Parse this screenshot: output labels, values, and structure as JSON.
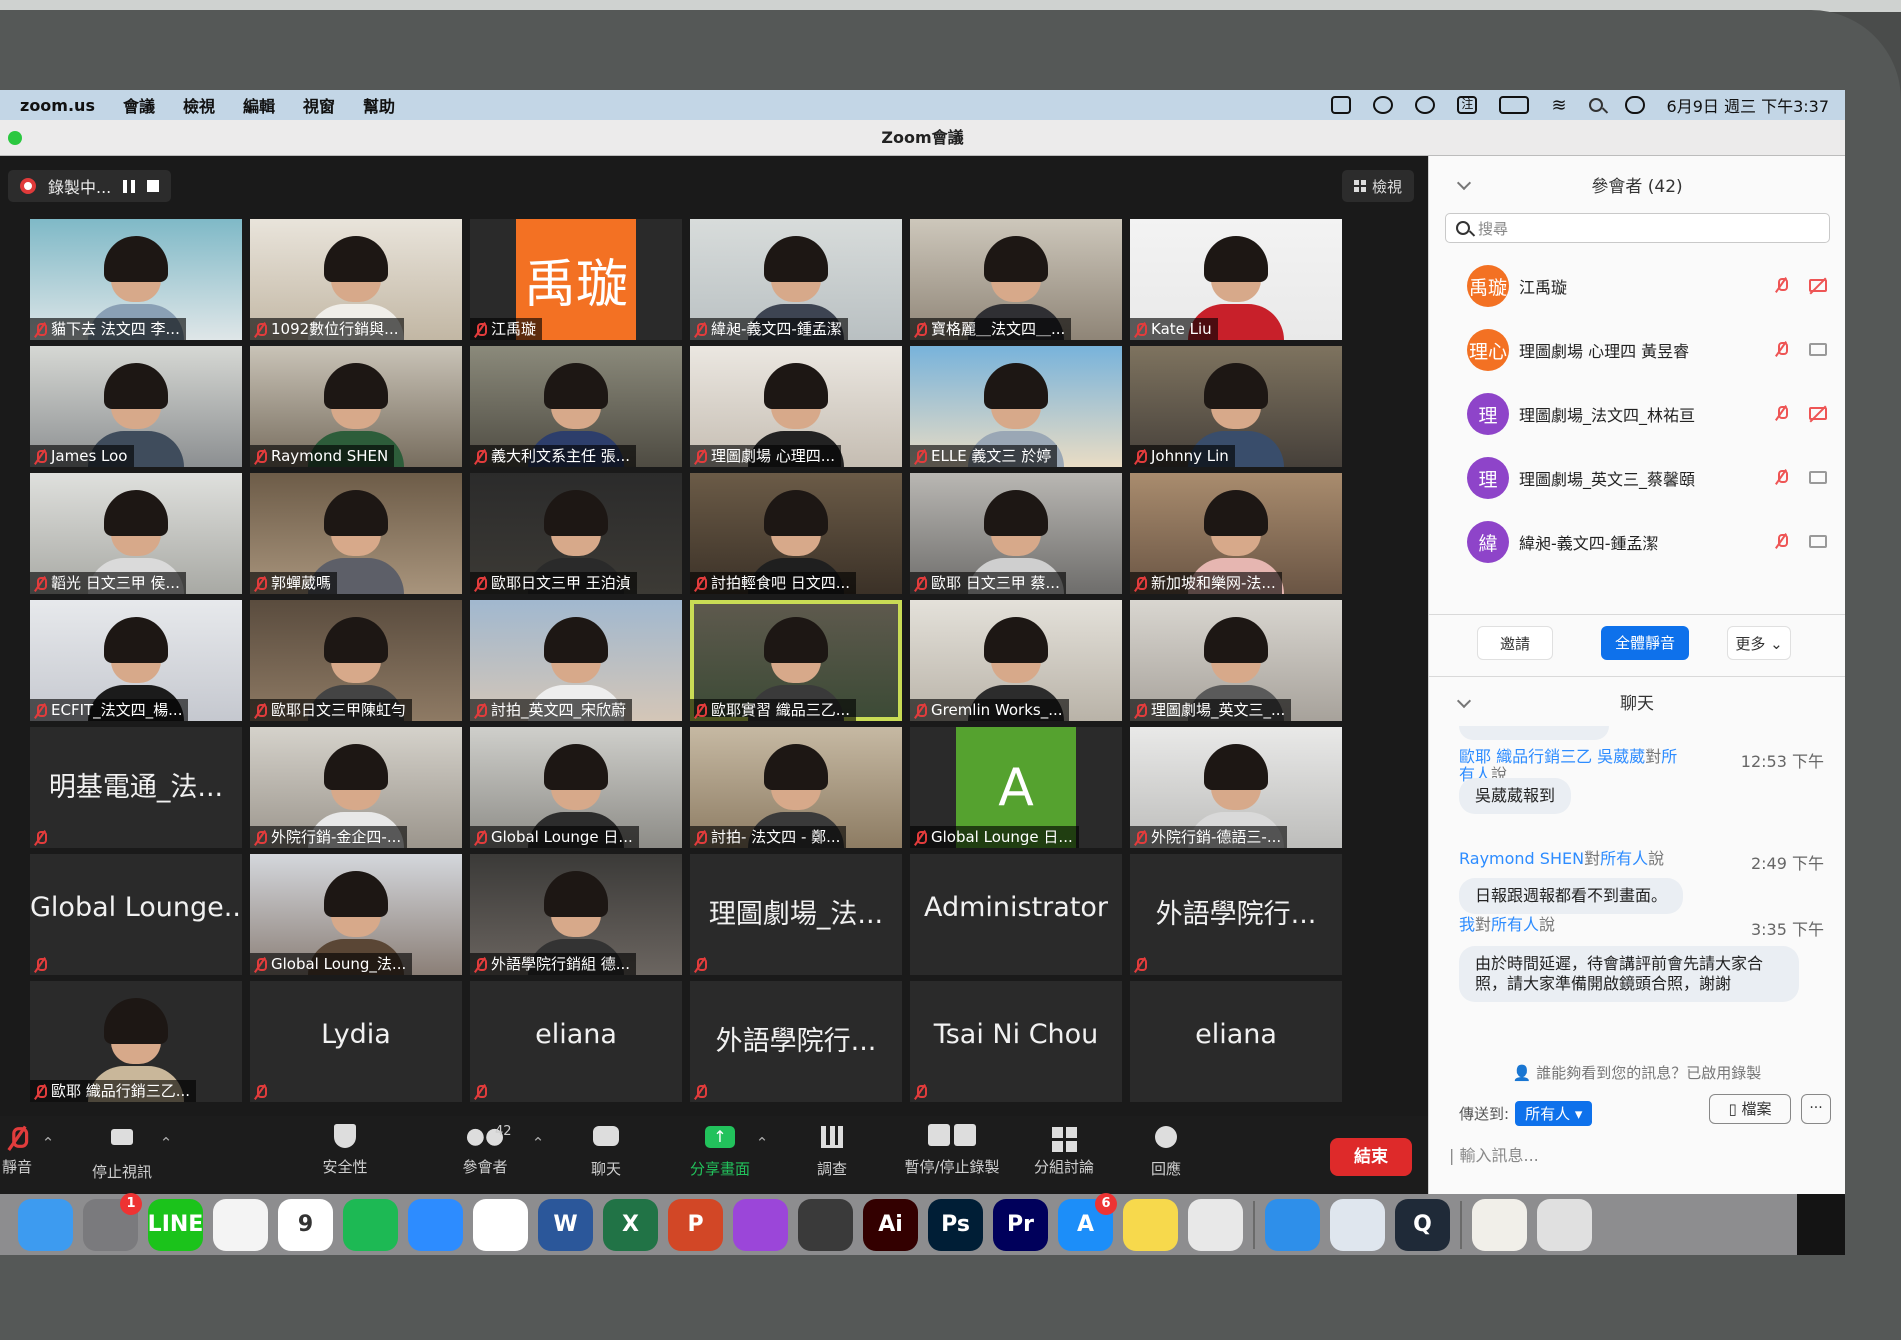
{
  "menubar": {
    "items": [
      "zoom.us",
      "會議",
      "檢視",
      "編輯",
      "視窗",
      "幫助"
    ],
    "clock": "6月9日 週三 下午3:37"
  },
  "window": {
    "title": "Zoom會議"
  },
  "recording": {
    "label": "錄製中..."
  },
  "view_button": {
    "label": "檢視"
  },
  "tiles": [
    {
      "name": "貓下去 法文四 李...",
      "type": "video",
      "bg": "#7fb9c7",
      "bg2": "#dfe6e8",
      "shirt": "#8aa0b5"
    },
    {
      "name": "1092數位行銷與...",
      "type": "video",
      "bg": "#e9e4db",
      "bg2": "#c2b7a4",
      "shirt": "#f0eee9"
    },
    {
      "name": "江禹璇",
      "type": "avatar",
      "letter": "禹璇",
      "color": "#f37123"
    },
    {
      "name": "緯昶-義文四-鍾孟潔",
      "type": "video",
      "bg": "#d8dcdb",
      "bg2": "#b9c0c2",
      "shirt": "#3d4452"
    },
    {
      "name": "寶格麗＿法文四＿...",
      "type": "video",
      "bg": "#cdc7bb",
      "bg2": "#8f8577",
      "shirt": "#2f2f33"
    },
    {
      "name": "Kate Liu",
      "type": "video",
      "bg": "#f3f3f3",
      "bg2": "#e9e9e9",
      "shirt": "#c8202a"
    },
    {
      "name": "James Loo",
      "type": "video",
      "bg": "#d6d8d4",
      "bg2": "#8c8f91",
      "shirt": "#3f4c5c"
    },
    {
      "name": "Raymond SHEN",
      "type": "video",
      "bg": "#c9c3b7",
      "bg2": "#776d5e",
      "shirt": "#2d5d3a"
    },
    {
      "name": "義大利文系主任 張...",
      "type": "video",
      "bg": "#8b8a7b",
      "bg2": "#4e4b42",
      "shirt": "#2d3e6b"
    },
    {
      "name": "理圖劇場 心理四...",
      "type": "video",
      "bg": "#ebe7e1",
      "bg2": "#c5bdb2",
      "shirt": "#222"
    },
    {
      "name": "ELLE 義文三 於婷",
      "type": "video",
      "bg": "#78b3db",
      "bg2": "#e9dcc4",
      "shirt": "#9aa7b5"
    },
    {
      "name": "Johnny Lin",
      "type": "video",
      "bg": "#7e735f",
      "bg2": "#46403a",
      "shirt": "#394d6b"
    },
    {
      "name": "韜光 日文三甲 侯...",
      "type": "video",
      "bg": "#dfe0dd",
      "bg2": "#a8a9a4",
      "shirt": "#dadada"
    },
    {
      "name": "郭蟬葳嗎",
      "type": "video",
      "bg": "#6d5c48",
      "bg2": "#a8947c",
      "shirt": "#5d5f68"
    },
    {
      "name": "歐耶日文三甲 王泊湞",
      "type": "video",
      "bg": "#2b2b2b",
      "bg2": "#3c3a35",
      "shirt": "#2a2a2a"
    },
    {
      "name": "討拍輕食吧 日文四...",
      "type": "video",
      "bg": "#6b5b47",
      "bg2": "#3b3127",
      "shirt": "#1f1f1f"
    },
    {
      "name": "歐耶 日文三甲 蔡...",
      "type": "video",
      "bg": "#b9b7b3",
      "bg2": "#6e6d6b",
      "shirt": "#cfcfcf"
    },
    {
      "name": "新加坡和樂网-法...",
      "type": "video",
      "bg": "#a98c6e",
      "bg2": "#6a5544",
      "shirt": "#e6b6b1"
    },
    {
      "name": "ECFIT_法文四_楊...",
      "type": "video",
      "bg": "#e7e9ec",
      "bg2": "#c5c8cf",
      "shirt": "#1b1b1b"
    },
    {
      "name": "歐耶日文三甲陳虹勻",
      "type": "video",
      "bg": "#5a4c3e",
      "bg2": "#8e7a64",
      "shirt": "#444"
    },
    {
      "name": "討拍_英文四_宋欣蔚",
      "type": "video",
      "bg": "#a1b8cf",
      "bg2": "#d4c6b7",
      "shirt": "#eee"
    },
    {
      "name": "歐耶實習 織品三乙...",
      "type": "video",
      "bg": "#5f5a4e",
      "bg2": "#3b4a35",
      "shirt": "#3a3a3a",
      "active": true
    },
    {
      "name": "Gremlin Works_...",
      "type": "video",
      "bg": "#e4e1da",
      "bg2": "#b9b3a8",
      "shirt": "#2c2c2c"
    },
    {
      "name": "理圖劇場_英文三_...",
      "type": "video",
      "bg": "#d9d6d0",
      "bg2": "#a7a29b",
      "shirt": "#5a5a5a"
    },
    {
      "name": "明基電通_法...",
      "type": "name"
    },
    {
      "name": "外院行銷-金企四-...",
      "type": "video",
      "bg": "#d5d2cb",
      "bg2": "#9b958c",
      "shirt": "#e8e8e8"
    },
    {
      "name": "Global Lounge 日...",
      "type": "video",
      "bg": "#cfcfcb",
      "bg2": "#8d8c87",
      "shirt": "#2c2c2c"
    },
    {
      "name": "討拍- 法文四 - 鄭...",
      "type": "video",
      "bg": "#c6b9a3",
      "bg2": "#8d7c63",
      "shirt": "#3a3a3a"
    },
    {
      "name": "Global Lounge 日...",
      "type": "avatar",
      "letter": "A",
      "color": "#55a22f"
    },
    {
      "name": "外院行銷-德語三-...",
      "type": "video",
      "bg": "#e9e9e8",
      "bg2": "#bdbdbb",
      "shirt": "#d9d9d9"
    },
    {
      "name": "Global Lounge...",
      "type": "name"
    },
    {
      "name": "Global Loung_法...",
      "type": "video",
      "bg": "#d4d7dc",
      "bg2": "#8b7f77",
      "shirt": "#5a4635"
    },
    {
      "name": "外語學院行銷組 德...",
      "type": "video",
      "bg": "#3b3a38",
      "bg2": "#6b6560",
      "shirt": "#333"
    },
    {
      "name": "理圖劇場_法...",
      "type": "name"
    },
    {
      "name": "Administrator",
      "type": "name",
      "nomute": true
    },
    {
      "name": "外語學院行...",
      "type": "name"
    },
    {
      "name": "歐耶 織品行銷三乙...",
      "type": "video",
      "bg": "#2a2a2a",
      "bg2": "#2a2a2a",
      "shirt": "#c9b79a"
    },
    {
      "name": "Lydia",
      "type": "name"
    },
    {
      "name": "eliana",
      "type": "name"
    },
    {
      "name": "外語學院行...",
      "type": "name"
    },
    {
      "name": "Tsai Ni Chou",
      "type": "name"
    },
    {
      "name": "eliana",
      "type": "name",
      "nomute": true
    }
  ],
  "toolbar": {
    "mute": "靜音",
    "stop_video": "停止視訊",
    "security": "安全性",
    "participants": "參會者",
    "participants_count": "42",
    "chat": "聊天",
    "share": "分享畫面",
    "polls": "調查",
    "record": "暫停/停止錄製",
    "breakout": "分組討論",
    "reactions": "回應",
    "end": "結束"
  },
  "dock": [
    {
      "name": "finder-icon",
      "color": "#3d9bf0",
      "text": ""
    },
    {
      "name": "system-preferences-icon",
      "color": "#7a7a7d",
      "text": "",
      "badge": "1"
    },
    {
      "name": "line-icon",
      "color": "#1bc31b",
      "text": "LINE"
    },
    {
      "name": "chrome-icon",
      "color": "#f4f4f4",
      "text": ""
    },
    {
      "name": "calendar-icon",
      "color": "#ffffff",
      "text": "9"
    },
    {
      "name": "spotify-icon",
      "color": "#1db954",
      "text": ""
    },
    {
      "name": "zoom-icon",
      "color": "#2d8cff",
      "text": ""
    },
    {
      "name": "reminders-icon",
      "color": "#ffffff",
      "text": ""
    },
    {
      "name": "word-icon",
      "color": "#2b579a",
      "text": "W"
    },
    {
      "name": "excel-icon",
      "color": "#217346",
      "text": "X"
    },
    {
      "name": "powerpoint-icon",
      "color": "#d24726",
      "text": "P"
    },
    {
      "name": "podcasts-icon",
      "color": "#9b46d9",
      "text": ""
    },
    {
      "name": "calculator-icon",
      "color": "#3a3a3a",
      "text": ""
    },
    {
      "name": "illustrator-icon",
      "color": "#330000",
      "text": "Ai"
    },
    {
      "name": "photoshop-icon",
      "color": "#001e36",
      "text": "Ps"
    },
    {
      "name": "premiere-icon",
      "color": "#00005b",
      "text": "Pr"
    },
    {
      "name": "app-store-icon",
      "color": "#1c8ef9",
      "text": "A",
      "badge": "6"
    },
    {
      "name": "notes-icon",
      "color": "#f7d94c",
      "text": ""
    },
    {
      "name": "launchpad-icon",
      "color": "#e8e8e8",
      "text": ""
    },
    {
      "name": "safari-icon",
      "color": "#2e8fea",
      "text": ""
    },
    {
      "name": "preview-icon",
      "color": "#dfe6ee",
      "text": ""
    },
    {
      "name": "quicktime-icon",
      "color": "#1f2a38",
      "text": "Q"
    },
    {
      "name": "document-icon",
      "color": "#f1efe9",
      "text": ""
    },
    {
      "name": "trash-icon",
      "color": "#e0e0e0",
      "text": ""
    }
  ],
  "participants_panel": {
    "title": "參會者 (42)",
    "search_placeholder": "搜尋",
    "people": [
      {
        "avatar": "禹璇",
        "name": "江禹璇",
        "color": "#f37123",
        "camera_off": true
      },
      {
        "avatar": "理心",
        "name": "理圖劇場 心理四 黃昱睿",
        "color": "#f37123",
        "camera_off": false
      },
      {
        "avatar": "理",
        "name": "理圖劇場_法文四_林祐亘",
        "color": "#8e44c9",
        "camera_off": true
      },
      {
        "avatar": "理",
        "name": "理圖劇場_英文三_蔡馨頤",
        "color": "#8e44c9",
        "camera_off": false
      },
      {
        "avatar": "緯",
        "name": "緯昶-義文四-鍾孟潔",
        "color": "#8e44c9",
        "camera_off": false
      }
    ],
    "invite": "邀請",
    "mute_all": "全體靜音",
    "more": "更多"
  },
  "chat_panel": {
    "title": "聊天",
    "messages": [
      {
        "sender": "歐耶 織品行銷三乙 吳葳葳",
        "to_word": "對",
        "to": "所有人",
        "say": "說",
        "time": "12:53 下午",
        "text": "吳葳葳報到"
      },
      {
        "sender": "Raymond SHEN",
        "to_word": "對",
        "to": "所有人",
        "say": "說",
        "time": "2:49 下午",
        "text": "日報跟週報都看不到畫面。"
      },
      {
        "sender": "我",
        "to_word": "對",
        "to": "所有人",
        "say": "說",
        "time": "3:35 下午",
        "text": "由於時間延遲，待會講評前會先請大家合照，請大家準備開啟鏡頭合照，謝謝"
      }
    ],
    "notice": "誰能夠看到您的訊息？已啟用錄製",
    "send_to_label": "傳送到:",
    "send_to_value": "所有人",
    "file_button": "檔案",
    "more_button": "···",
    "input_placeholder": "輸入訊息..."
  }
}
